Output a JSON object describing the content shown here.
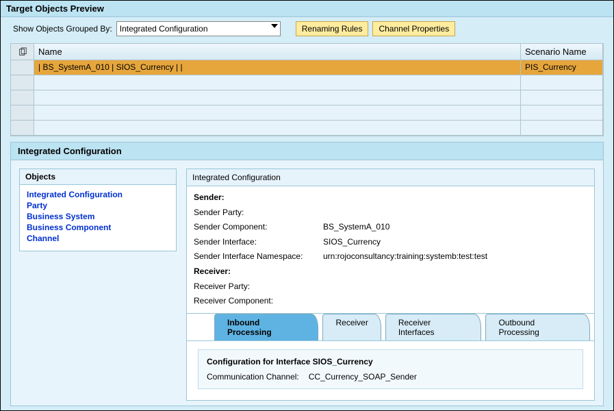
{
  "panel_title": "Target Objects Preview",
  "toolbar": {
    "group_by_label": "Show Objects Grouped By:",
    "group_by_value": "Integrated Configuration",
    "renaming_rules_label": "Renaming Rules",
    "channel_properties_label": "Channel Properties"
  },
  "grid": {
    "columns": {
      "name": "Name",
      "scenario": "Scenario Name"
    },
    "rows": [
      {
        "name": "| BS_SystemA_010 | SIOS_Currency |  |",
        "scenario": "PIS_Currency",
        "selected": true
      },
      {
        "name": "",
        "scenario": ""
      },
      {
        "name": "",
        "scenario": ""
      },
      {
        "name": "",
        "scenario": ""
      },
      {
        "name": "",
        "scenario": ""
      }
    ]
  },
  "section_title": "Integrated Configuration",
  "objects": {
    "title": "Objects",
    "items": [
      "Integrated Configuration",
      "Party",
      "Business System",
      "Business Component",
      "Channel"
    ]
  },
  "detail": {
    "title": "Integrated Configuration",
    "sender_label": "Sender:",
    "sender_party_label": "Sender Party:",
    "sender_party_value": "",
    "sender_component_label": "Sender Component:",
    "sender_component_value": "BS_SystemA_010",
    "sender_interface_label": "Sender Interface:",
    "sender_interface_value": "SIOS_Currency",
    "sender_ns_label": "Sender Interface Namespace:",
    "sender_ns_value": "urn:rojoconsultancy:training:systemb:test:test",
    "receiver_label": "Receiver:",
    "receiver_party_label": "Receiver Party:",
    "receiver_party_value": "",
    "receiver_component_label": "Receiver Component:",
    "receiver_component_value": ""
  },
  "tabs": [
    {
      "id": "inbound",
      "label": "Inbound Processing",
      "active": true
    },
    {
      "id": "receiver",
      "label": "Receiver",
      "active": false
    },
    {
      "id": "recvif",
      "label": "Receiver Interfaces",
      "active": false
    },
    {
      "id": "outbound",
      "label": "Outbound Processing",
      "active": false
    }
  ],
  "tab_content": {
    "inbound": {
      "box_title": "Configuration for Interface SIOS_Currency",
      "cc_label": "Communication Channel:",
      "cc_value": "CC_Currency_SOAP_Sender"
    }
  }
}
